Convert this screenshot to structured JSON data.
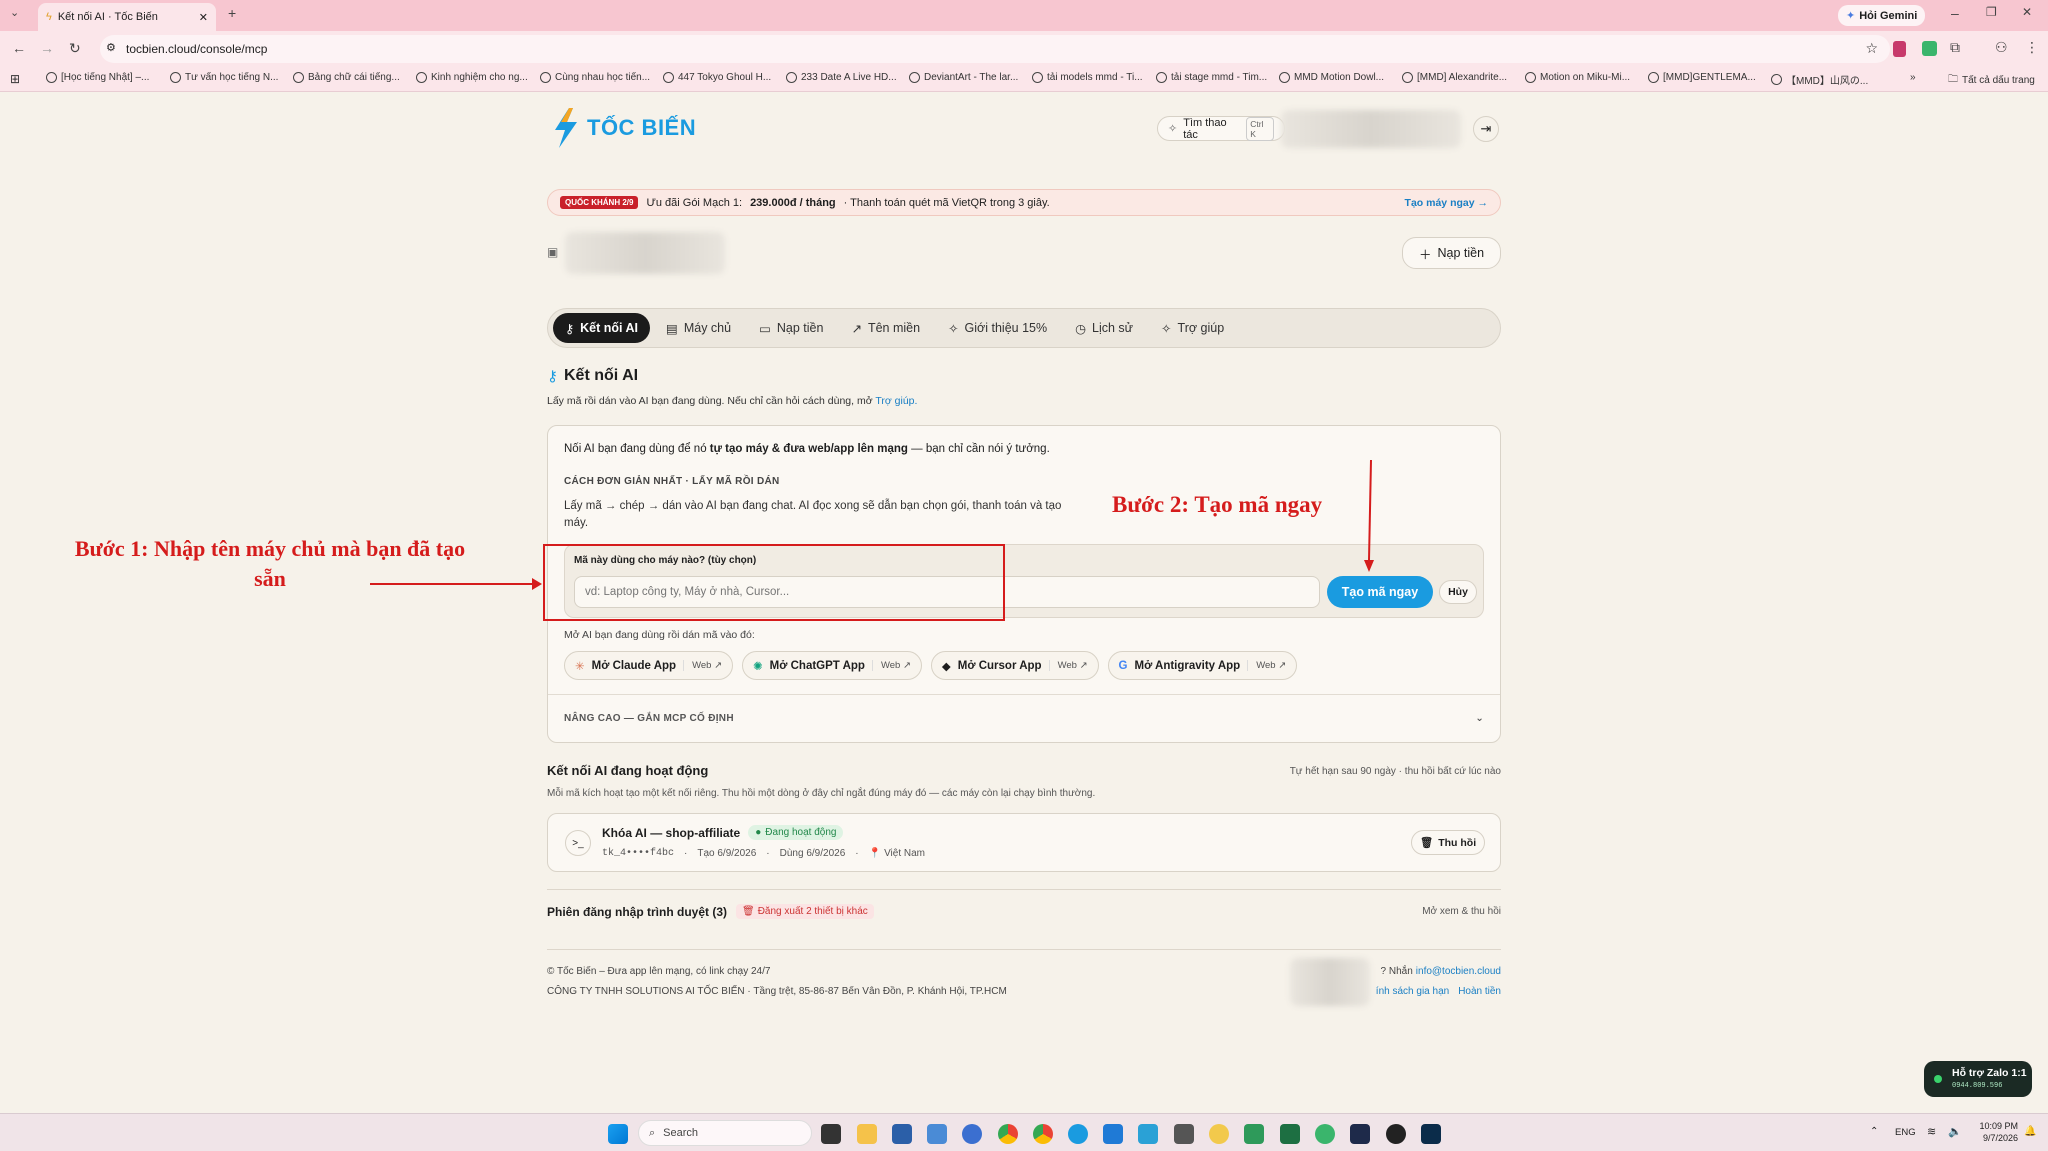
{
  "browser": {
    "tab_title": "Kết nối AI · Tốc Biến",
    "url": "tocbien.cloud/console/mcp",
    "gemini": "Hỏi Gemini",
    "bookmarks": [
      "[Học tiếng Nhật] –...",
      "Tư vấn học tiếng N...",
      "Bảng chữ cái tiếng...",
      "Kinh nghiệm cho ng...",
      "Cùng nhau học tiến...",
      "447 Tokyo Ghoul H...",
      "233 Date A Live HD...",
      "DeviantArt - The lar...",
      "tải models mmd - Ti...",
      "tải stage mmd - Tim...",
      "MMD Motion Dowl...",
      "[MMD] Alexandrite...",
      "Motion on Miku-Mi...",
      "[MMD]GENTLEMA...",
      "【MMD】山风の..."
    ],
    "all_bookmarks": "Tất cả dấu trang"
  },
  "header": {
    "logo_text": "TỐC BIẾN",
    "search_label": "Tìm thao tác",
    "search_shortcut": "Ctrl K"
  },
  "promo": {
    "badge": "QUỐC KHÁNH 2/9",
    "text_prefix": "Ưu đãi Gói Mạch 1:",
    "price": "239.000đ / tháng",
    "text_suffix": "· Thanh toán quét mã VietQR trong 3 giây.",
    "cta": "Tạo máy ngay →"
  },
  "topup_button": "Nạp tiền",
  "nav": {
    "tabs": [
      {
        "label": "Kết nối AI",
        "icon": "key-icon"
      },
      {
        "label": "Máy chủ",
        "icon": "server-icon"
      },
      {
        "label": "Nạp tiền",
        "icon": "wallet-icon"
      },
      {
        "label": "Tên miền",
        "icon": "link-icon"
      },
      {
        "label": "Giới thiệu 15%",
        "icon": "sparkle-icon"
      },
      {
        "label": "Lịch sử",
        "icon": "history-icon"
      },
      {
        "label": "Trợ giúp",
        "icon": "help-icon"
      }
    ]
  },
  "section": {
    "title": "Kết nối AI",
    "subtitle": "Lấy mã rồi dán vào AI bạn đang dùng. Nếu chỉ cần hỏi cách dùng, mở",
    "subtitle_link": "Trợ giúp."
  },
  "main_card": {
    "intro_prefix": "Nối AI bạn đang dùng để nó",
    "intro_bold": "tự tạo máy & đưa web/app lên mạng",
    "intro_suffix": "— bạn chỉ cần nói ý tưởng.",
    "method_heading": "CÁCH ĐƠN GIẢN NHẤT · LẤY MÃ RỒI DÁN",
    "method_desc": "Lấy mã → chép → dán vào AI bạn đang chat. AI đọc xong sẽ dẫn bạn chọn gói, thanh toán và tạo máy.",
    "input_label": "Mã này dùng cho máy nào? (tùy chọn)",
    "input_placeholder": "vd: Laptop công ty, Máy ở nhà, Cursor...",
    "create_button": "Tạo mã ngay",
    "cancel_button": "Hủy",
    "open_apps_label": "Mở AI bạn đang dùng rồi dán mã vào đó:",
    "apps": [
      {
        "label": "Mở Claude App",
        "web": "Web ↗"
      },
      {
        "label": "Mở ChatGPT App",
        "web": "Web ↗"
      },
      {
        "label": "Mở Cursor App",
        "web": "Web ↗"
      },
      {
        "label": "Mở Antigravity App",
        "web": "Web ↗"
      }
    ],
    "advanced": "NÂNG CAO — GẮN MCP CỐ ĐỊNH"
  },
  "annotations": {
    "step1": "Bước 1: Nhập tên máy chủ mà bạn đã tạo sẵn",
    "step2": "Bước 2: Tạo mã ngay"
  },
  "active": {
    "title": "Kết nối AI đang hoạt động",
    "right_note": "Tự hết hạn sau 90 ngày · thu hồi bất cứ lúc nào",
    "desc": "Mỗi mã kích hoạt tạo một kết nối riêng. Thu hồi một dòng ở đây chỉ ngắt đúng máy đó — các máy còn lại chạy bình thường.",
    "item": {
      "name": "Khóa AI — shop-affiliate",
      "status": "Đang hoạt động",
      "token": "tk_4••••f4bc",
      "created": "Tạo 6/9/2026",
      "used": "Dùng 6/9/2026",
      "location": "Việt Nam",
      "revoke": "Thu hồi"
    }
  },
  "sessions": {
    "title": "Phiên đăng nhập trình duyệt (3)",
    "logout_others": "Đăng xuất 2 thiết bị khác",
    "right": "Mở xem & thu hồi"
  },
  "footer": {
    "line1": "© Tốc Biến – Đưa app lên mạng, có link chạy 24/7",
    "line2": "CÔNG TY TNHH SOLUTIONS AI TỐC BIẾN · Tầng trệt, 85-86-87 Bến Vân Đồn, P. Khánh Hội, TP.HCM",
    "right1_prefix": "? Nhắn",
    "email": "info@tocbien.cloud",
    "link_policy": "ính sách gia hạn",
    "link_refund": "Hoàn tiền"
  },
  "zalo": {
    "title": "Hỗ trợ Zalo 1:1",
    "phone": "0944.809.596"
  },
  "taskbar": {
    "search": "Search",
    "lang": "ENG",
    "time": "10:09 PM",
    "date": "9/7/2026"
  },
  "colors": {
    "accent": "#1a9be0",
    "primary_dark": "#1b1b1b",
    "annotation_red": "#d51c1c",
    "promo_bg": "#fbe9e4"
  }
}
